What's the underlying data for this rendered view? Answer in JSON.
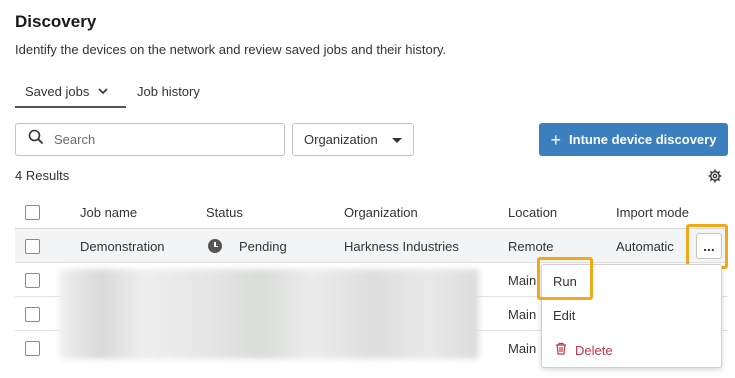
{
  "page": {
    "title": "Discovery",
    "subtitle": "Identify the devices on the network and review saved jobs and their history."
  },
  "tabs": [
    {
      "label": "Saved jobs",
      "active": true
    },
    {
      "label": "Job history",
      "active": false
    }
  ],
  "toolbar": {
    "search_placeholder": "Search",
    "organization_label": "Organization",
    "primary_button": "Intune device discovery"
  },
  "results_label": "4 Results",
  "table": {
    "columns": [
      "Job name",
      "Status",
      "Organization",
      "Location",
      "Import mode"
    ],
    "rows": [
      {
        "job_name": "Demonstration",
        "status": "Pending",
        "organization": "Harkness Industries",
        "location": "Remote",
        "import_mode": "Automatic"
      },
      {
        "job_name": "",
        "status": "",
        "organization": "",
        "location": "Main",
        "import_mode": ""
      },
      {
        "job_name": "",
        "status": "",
        "organization": "",
        "location": "Main",
        "import_mode": ""
      },
      {
        "job_name": "",
        "status": "",
        "organization": "",
        "location": "Main",
        "import_mode": ""
      }
    ]
  },
  "row_actions_button": "...",
  "context_menu": {
    "items": [
      "Run",
      "Edit",
      "Delete"
    ]
  },
  "colors": {
    "primary": "#3c7fbf",
    "highlight": "#f0a91a",
    "danger": "#c8334a"
  },
  "icons": [
    "chevron-down-icon",
    "search-icon",
    "caret-down-icon",
    "plus-icon",
    "gear-icon",
    "clock-icon",
    "more-icon",
    "trash-icon"
  ]
}
